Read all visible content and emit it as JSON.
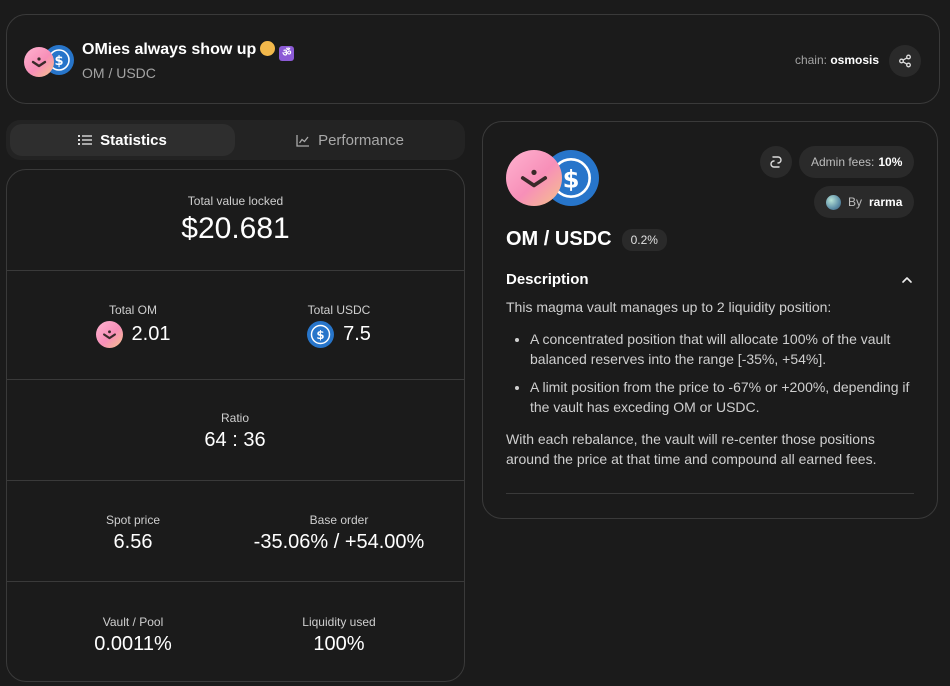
{
  "header": {
    "title": "OMies always show up",
    "title_emoji_om": "ॐ",
    "pair": "OM / USDC",
    "chain_label": "chain:",
    "chain_value": "osmosis"
  },
  "tabs": [
    {
      "label": "Statistics",
      "active": true
    },
    {
      "label": "Performance",
      "active": false
    }
  ],
  "stats": {
    "tvl_label": "Total value locked",
    "tvl_value": "$20.681",
    "total_om_label": "Total OM",
    "total_om_value": "2.01",
    "total_usdc_label": "Total USDC",
    "total_usdc_value": "7.5",
    "ratio_label": "Ratio",
    "ratio_value": "64 : 36",
    "spot_price_label": "Spot price",
    "spot_price_value": "6.56",
    "base_order_label": "Base order",
    "base_order_value": "-35.06% / +54.00%",
    "vault_pool_label": "Vault / Pool",
    "vault_pool_value": "0.0011%",
    "liquidity_label": "Liquidity used",
    "liquidity_value": "100%"
  },
  "info": {
    "admin_fees_label": "Admin fees:",
    "admin_fees_value": "10%",
    "by_label": "By",
    "by_value": "rarma",
    "pair": "OM / USDC",
    "fee_tier": "0.2%",
    "description_heading": "Description",
    "description_intro": "This magma vault manages up to 2 liquidity position:",
    "description_points": [
      "A concentrated position that will allocate 100% of the vault balanced reserves into the range [-35%, +54%].",
      "A limit position from the price to -67% or +200%, depending if the vault has exceding OM or USDC."
    ],
    "description_outro": "With each rebalance, the vault will re-center those positions around the price at that time and compound all earned fees."
  },
  "colors": {
    "background": "#1b1b1b",
    "border": "#3a3a3a",
    "usdc_blue": "#2775ca",
    "om_pink": "#f78fb8"
  },
  "icons": [
    "share-icon",
    "list-icon",
    "chart-icon",
    "refresh-icon",
    "chevron-up-icon"
  ]
}
